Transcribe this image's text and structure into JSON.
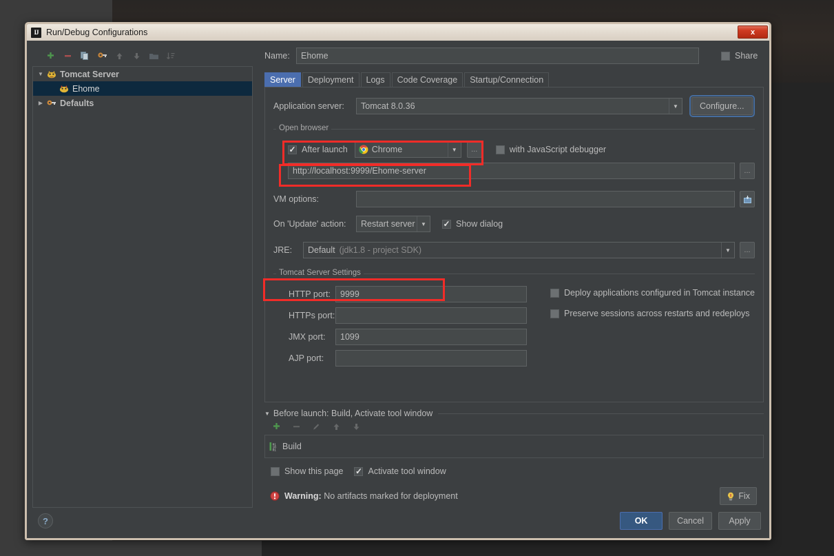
{
  "window": {
    "title": "Run/Debug Configurations",
    "app_icon": "IJ",
    "close_label": "x"
  },
  "tree_toolbar": [
    {
      "name": "add-icon",
      "glyph": "+"
    },
    {
      "name": "remove-icon",
      "glyph": "–"
    },
    {
      "name": "copy-icon",
      "glyph": "❐"
    },
    {
      "name": "edit-templates-icon",
      "glyph": "⚙"
    },
    {
      "name": "move-up-icon",
      "glyph": "↑"
    },
    {
      "name": "move-down-icon",
      "glyph": "↓"
    },
    {
      "name": "folder-icon",
      "glyph": "▬"
    },
    {
      "name": "sort-icon",
      "glyph": "↓≡"
    }
  ],
  "tree": {
    "items": [
      {
        "label": "Tomcat Server",
        "level": 0,
        "expanded": true,
        "selected": false,
        "arrow": "▼",
        "icon": "tomcat-icon"
      },
      {
        "label": "Ehome",
        "level": 1,
        "expanded": false,
        "selected": true,
        "arrow": "",
        "icon": "tomcat-icon"
      },
      {
        "label": "Defaults",
        "level": 0,
        "expanded": false,
        "selected": false,
        "arrow": "▶",
        "icon": "defaults-icon"
      }
    ]
  },
  "name_row": {
    "label": "Name:",
    "value": "Ehome",
    "share_label": "Share",
    "share_checked": false
  },
  "tabs": [
    {
      "label": "Server",
      "active": true
    },
    {
      "label": "Deployment",
      "active": false
    },
    {
      "label": "Logs",
      "active": false
    },
    {
      "label": "Code Coverage",
      "active": false
    },
    {
      "label": "Startup/Connection",
      "active": false
    }
  ],
  "server_tab": {
    "application_server": {
      "label": "Application server:",
      "value": "Tomcat 8.0.36",
      "configure_button": "Configure..."
    },
    "open_browser": {
      "group_title": "Open browser",
      "after_launch_label": "After launch",
      "after_launch_checked": true,
      "browser": "Chrome",
      "browser_icon": "chrome-icon",
      "dots_label": "...",
      "js_debugger_label": "with JavaScript debugger",
      "js_debugger_checked": false,
      "url": "http://localhost:9999/Ehome-server",
      "url_dots_label": "..."
    },
    "vm_options": {
      "label": "VM options:",
      "value": "",
      "expand_icon": "expand-editor-icon"
    },
    "update_action": {
      "label": "On 'Update' action:",
      "value": "Restart server",
      "show_dialog_label": "Show dialog",
      "show_dialog_checked": true
    },
    "jre": {
      "label": "JRE:",
      "value": "Default",
      "hint": "(jdk1.8 - project SDK)",
      "dots_label": "..."
    },
    "tomcat_settings": {
      "group_title": "Tomcat Server Settings",
      "ports": [
        {
          "label": "HTTP port:",
          "value": "9999"
        },
        {
          "label": "HTTPs port:",
          "value": ""
        },
        {
          "label": "JMX port:",
          "value": "1099"
        },
        {
          "label": "AJP port:",
          "value": ""
        }
      ],
      "checkboxes": [
        {
          "label": "Deploy applications configured in Tomcat instance",
          "checked": false
        },
        {
          "label": "Preserve sessions across restarts and redeploys",
          "checked": false
        }
      ]
    }
  },
  "before_launch": {
    "header": "Before launch: Build, Activate tool window",
    "toolbar": [
      {
        "name": "add-task-icon",
        "glyph": "+"
      },
      {
        "name": "remove-task-icon",
        "glyph": "–"
      },
      {
        "name": "edit-task-icon",
        "glyph": "✎"
      },
      {
        "name": "move-task-up-icon",
        "glyph": "↑"
      },
      {
        "name": "move-task-down-icon",
        "glyph": "↓"
      }
    ],
    "tasks": [
      {
        "label": "Build",
        "icon": "build-icon"
      }
    ],
    "show_page_label": "Show this page",
    "show_page_checked": false,
    "activate_tool_window_label": "Activate tool window",
    "activate_tool_window_checked": true
  },
  "warning": {
    "icon": "warning-icon",
    "prefix": "Warning:",
    "message": "No artifacts marked for deployment",
    "fix_button": "Fix"
  },
  "footer": {
    "help_label": "?",
    "ok_label": "OK",
    "cancel_label": "Cancel",
    "apply_label": "Apply"
  },
  "colors": {
    "accent": "#4b6eaf",
    "primary_button": "#365880",
    "highlight_red": "#f22c28",
    "panel_bg": "#3c3f41",
    "field_bg": "#45494a",
    "text": "#bbbbbb"
  }
}
